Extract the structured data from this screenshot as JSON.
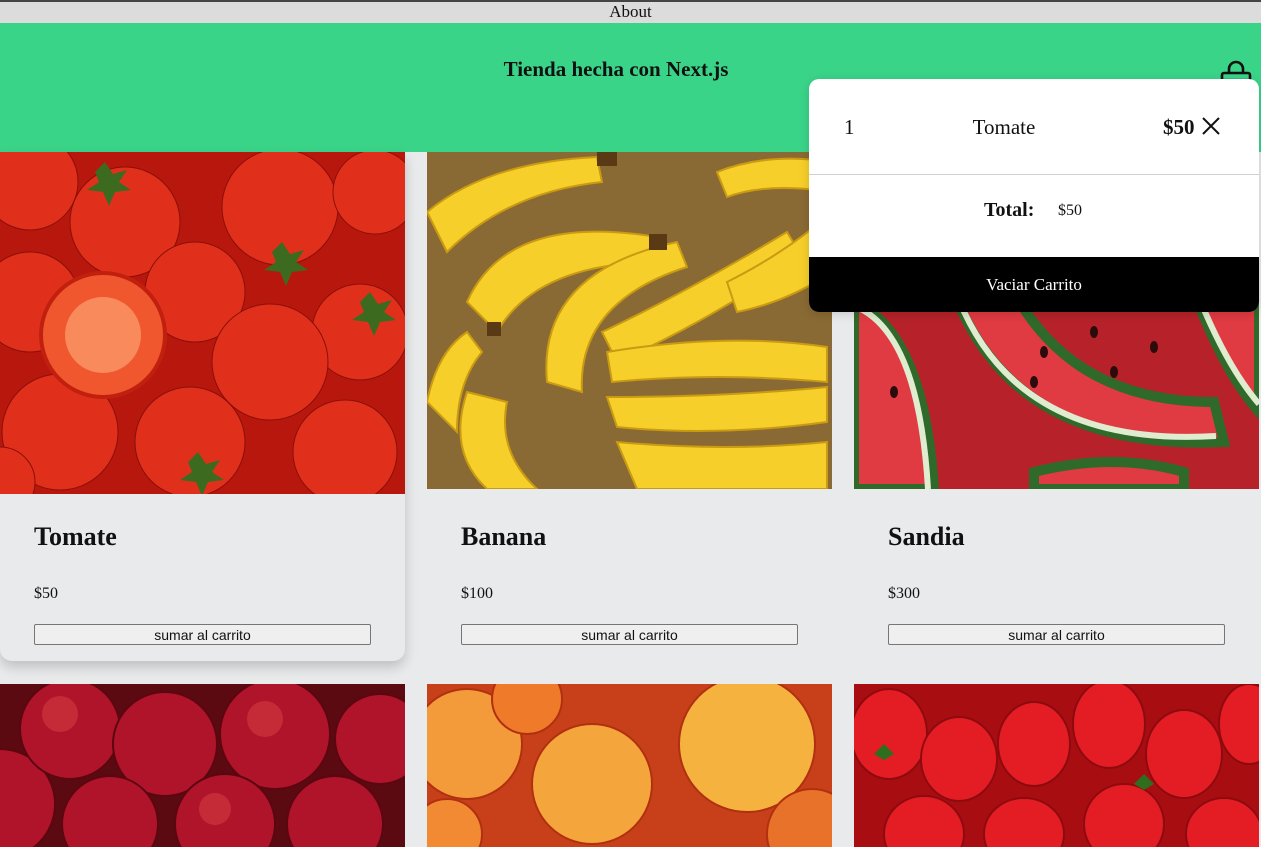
{
  "nav": {
    "about_label": "About"
  },
  "header": {
    "title": "Tienda hecha con Next.js"
  },
  "products": [
    {
      "name": "Tomate",
      "price": "$50",
      "button": "sumar al carrito"
    },
    {
      "name": "Banana",
      "price": "$100",
      "button": "sumar al carrito"
    },
    {
      "name": "Sandia",
      "price": "$300",
      "button": "sumar al carrito"
    }
  ],
  "cart": {
    "items": [
      {
        "qty": "1",
        "name": "Tomate",
        "price": "$50"
      }
    ],
    "total_label": "Total:",
    "total_value": "$50",
    "clear_label": "Vaciar Carrito"
  },
  "colors": {
    "header_bg": "#3ad489",
    "page_bg": "#e8eaeb",
    "clear_button_bg": "#000000"
  },
  "icons": {
    "cart": "shopping-bag-icon",
    "remove": "close-icon"
  }
}
